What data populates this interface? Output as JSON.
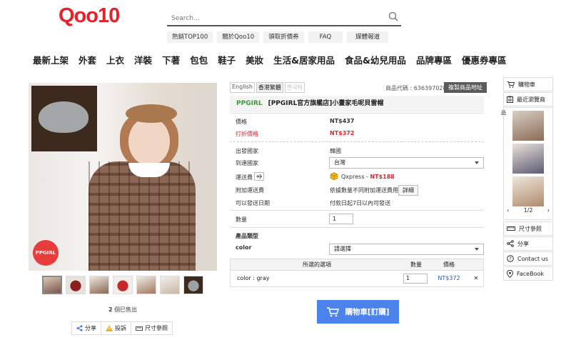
{
  "logo": "Qoo10",
  "search": {
    "placeholder": "Search..."
  },
  "top_links": [
    "熱銷TOP100",
    "關於Qoo10",
    "領取折價券",
    "FAQ",
    "媒體報道"
  ],
  "nav": [
    "最新上架",
    "外套",
    "上衣",
    "洋裝",
    "下著",
    "包包",
    "鞋子",
    "美妝",
    "生活&居家用品",
    "食品&幼兒用品",
    "品牌專區",
    "優惠券專區"
  ],
  "image": {
    "badge": "PPGIRL",
    "sold_count": "2",
    "sold_label": "個已售出"
  },
  "share": {
    "share": "分享",
    "report": "投訴",
    "size": "尺寸參照"
  },
  "languages": [
    "English",
    "香港繁體",
    "한국어"
  ],
  "product": {
    "code": "商品代碼 : 636397028",
    "copy_button": "複製商品地址",
    "brand": "PPGIRL",
    "title": "[PPGIRL官方旗艦店]小畫家毛呢貝雷帽",
    "price_label": "價格",
    "price": "NT$437",
    "discount_label": "打折價格",
    "discount_price": "NT$372",
    "origin_label": "出發國家",
    "origin": "韓國",
    "dest_label": "到達國家",
    "dest": "台灣",
    "ship_label": "運送費",
    "ship_method": "Qxpress - ",
    "ship_price": "NT$188",
    "extra_label": "附加運送費",
    "extra": "依據數量不同附加運送費用",
    "detail_button": "詳細",
    "date_label": "可以發送日期",
    "date": "付款日起7日以內可發送",
    "qty_label": "數量",
    "qty": "1",
    "type_label": "產品類型",
    "color_label": "color",
    "color_select": "請選擇"
  },
  "options_table": {
    "headers": [
      "所選的選項",
      "數量",
      "價格"
    ],
    "row": {
      "option": "color : gray",
      "qty": "1",
      "price": "NT$372"
    }
  },
  "cart_button": "購物車[訂購]",
  "sidebar": {
    "cart": "購物車",
    "recent": "最近瀏覽商",
    "recent_prefix": "品",
    "pager": "1/2",
    "size": "尺寸參照",
    "share": "分享",
    "contact": "Contact us",
    "facebook": "FaceBook"
  },
  "colors": {
    "accent_red": "#e8202a",
    "cart_blue": "#4c82ec",
    "brand_green": "#3c9a3c"
  }
}
